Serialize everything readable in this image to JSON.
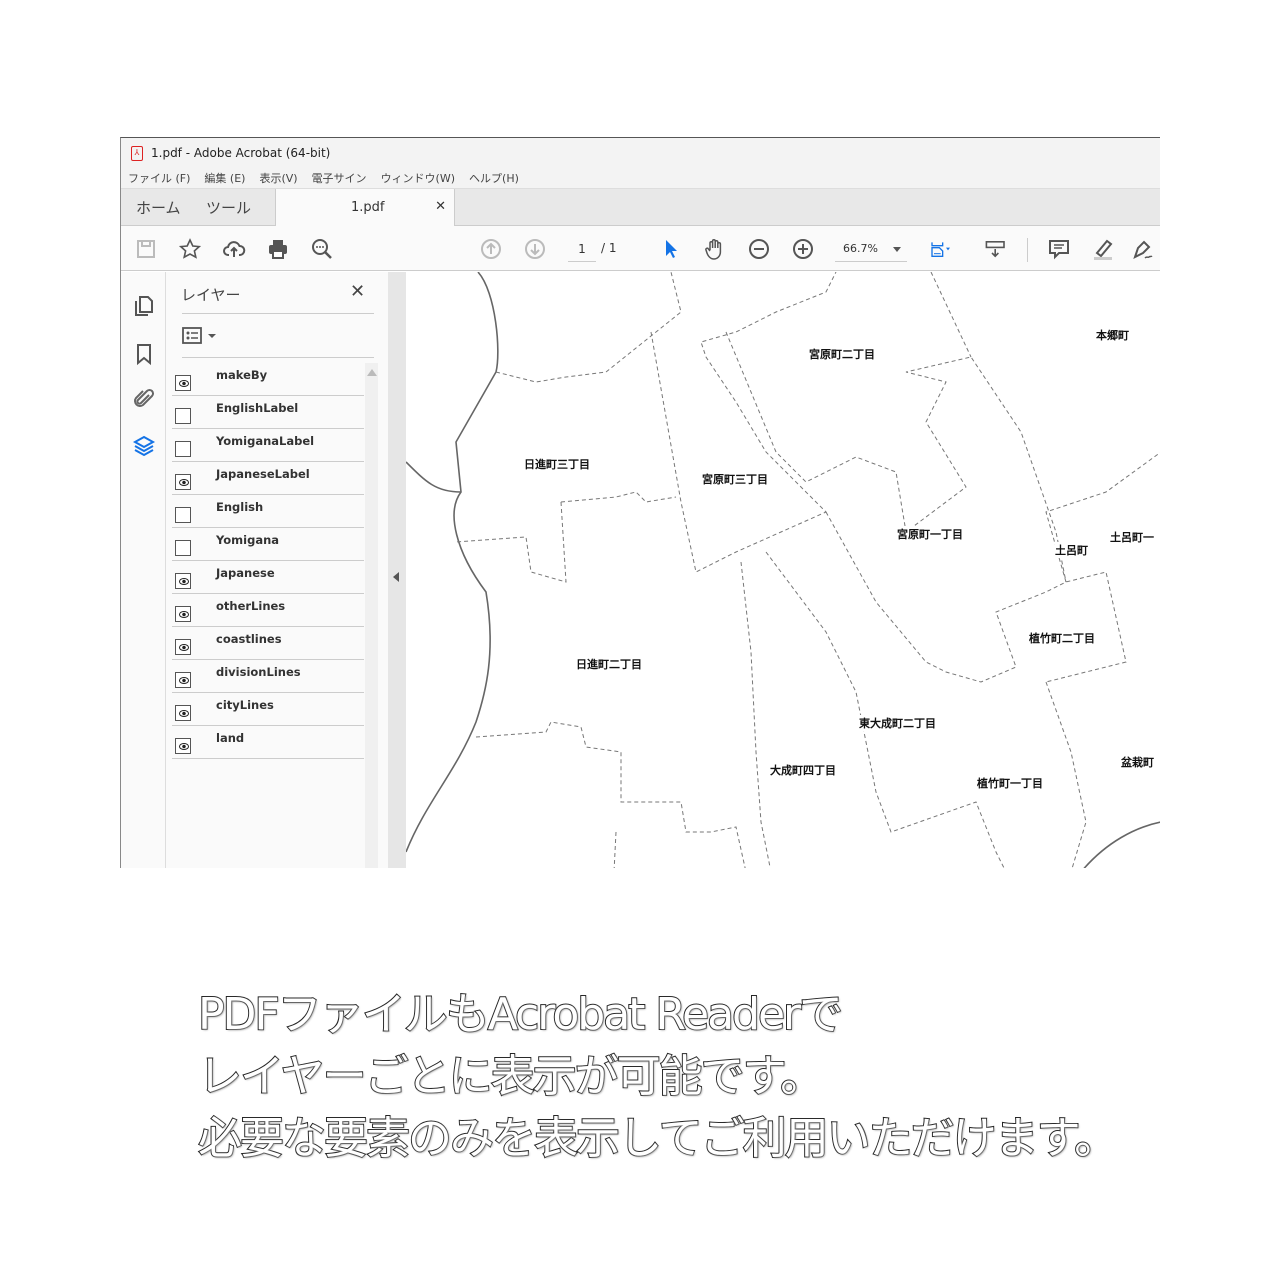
{
  "window": {
    "title": "1.pdf - Adobe Acrobat (64-bit)"
  },
  "menu": [
    "ファイル (F)",
    "編集 (E)",
    "表示(V)",
    "電子サイン",
    "ウィンドウ(W)",
    "ヘルプ(H)"
  ],
  "tabs": {
    "home": "ホーム",
    "tools": "ツール",
    "document": "1.pdf"
  },
  "toolbar": {
    "page_current": "1",
    "page_total": "/ 1",
    "zoom": "66.7%"
  },
  "panel": {
    "title": "レイヤー",
    "layers": [
      {
        "name": "makeBy",
        "visible": true
      },
      {
        "name": "EnglishLabel",
        "visible": false
      },
      {
        "name": "YomiganaLabel",
        "visible": false
      },
      {
        "name": "JapaneseLabel",
        "visible": true
      },
      {
        "name": "English",
        "visible": false
      },
      {
        "name": "Yomigana",
        "visible": false
      },
      {
        "name": "Japanese",
        "visible": true
      },
      {
        "name": "otherLines",
        "visible": true
      },
      {
        "name": "coastlines",
        "visible": true
      },
      {
        "name": "divisionLines",
        "visible": true
      },
      {
        "name": "cityLines",
        "visible": true
      },
      {
        "name": "land",
        "visible": true
      }
    ]
  },
  "map": {
    "labels": [
      "宮原町二丁目",
      "本郷町",
      "日進町三丁目",
      "宮原町三丁目",
      "宮原町一丁目",
      "土呂町",
      "土呂町一",
      "植竹町二丁目",
      "日進町二丁目",
      "東大成町二丁目",
      "大成町四丁目",
      "植竹町一丁目",
      "盆栽町"
    ]
  },
  "caption": [
    "PDFファイルもAcrobat Readerで",
    "レイヤーごとに表示が可能です。",
    "必要な要素のみを表示してご利用いただけます。"
  ],
  "colors": {
    "accent": "#1473e6",
    "pdf_icon": "#dd2222"
  }
}
